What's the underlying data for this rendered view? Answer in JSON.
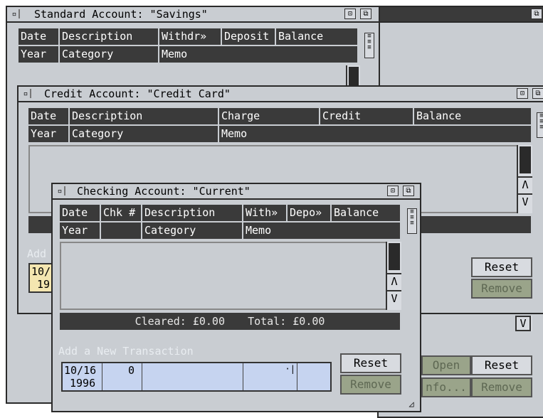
{
  "windows": {
    "savings": {
      "title": "Standard Account: \"Savings\"",
      "header_row1": [
        "Date",
        "Description",
        "Withdr»",
        "Deposit",
        "Balance"
      ],
      "header_row2": [
        "Year",
        "Category",
        "Memo"
      ]
    },
    "credit": {
      "title": "Credit Account: \"Credit Card\"",
      "header_row1": [
        "Date",
        "Description",
        "Charge",
        "Credit",
        "Balance"
      ],
      "header_row2": [
        "Year",
        "Category",
        "Memo"
      ],
      "add_label_partial": "Add",
      "entry_date_partial": [
        "10/",
        "19"
      ],
      "reset_label": "Reset",
      "remove_label": "Remove"
    },
    "checking": {
      "title": "Checking Account: \"Current\"",
      "header_row1": [
        "Date",
        "Chk #",
        "Description",
        "With»",
        "Depo»",
        "Balance"
      ],
      "header_row2": [
        "Year",
        "",
        "Category",
        "Memo"
      ],
      "cleared_label": "Cleared:",
      "cleared_value": "£0.00",
      "total_label": "Total:",
      "total_value": "£0.00",
      "add_label": "Add a New Transaction",
      "entry": {
        "date": "10/16",
        "year": "1996",
        "check": "0"
      },
      "reset_label": "Reset",
      "remove_label": "Remove"
    },
    "background": {
      "open_label": "Open",
      "info_label": "nfo...",
      "reset_label": "Reset",
      "remove_label": "Remove"
    }
  },
  "icons": {
    "close": "close-icon",
    "zoom": "zoom-icon",
    "depth": "depth-icon",
    "scroll_up": "Λ",
    "scroll_down": "V"
  }
}
